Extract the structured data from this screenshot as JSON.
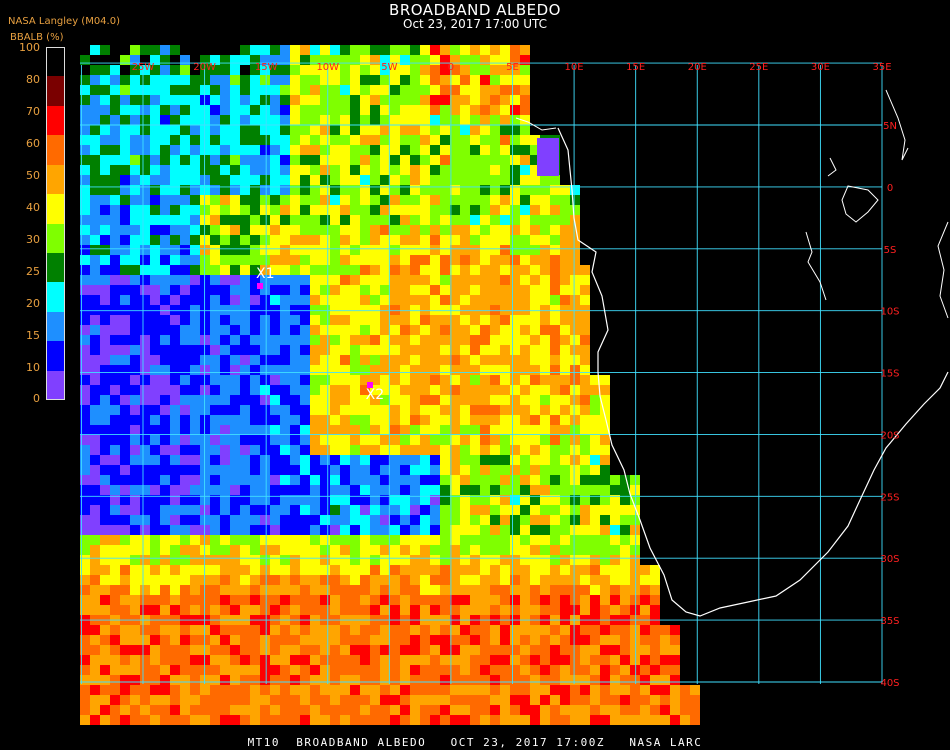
{
  "header": {
    "title": "BROADBAND ALBEDO",
    "datetime": "Oct 23, 2017 17:00 UTC",
    "source": "NASA Langley (M04.0)",
    "parameter": "BBALB (%)"
  },
  "legend": {
    "labels": [
      "100",
      "80",
      "70",
      "60",
      "50",
      "40",
      "30",
      "25",
      "20",
      "15",
      "10",
      "0"
    ],
    "colors": [
      "#000000",
      "#7a0000",
      "#ff0000",
      "#ff6a00",
      "#ffa500",
      "#ffff00",
      "#7fff00",
      "#008000",
      "#00ffff",
      "#1e8fff",
      "#0000ff",
      "#8040ff"
    ]
  },
  "map": {
    "lon_labels": [
      "25W",
      "20W",
      "15W",
      "10W",
      "5W",
      "0",
      "5E",
      "10E",
      "15E",
      "20E",
      "25E",
      "30E",
      "35E"
    ],
    "lat_labels": [
      "5N",
      "0",
      "5S",
      "10S",
      "15S",
      "20S",
      "25S",
      "30S",
      "35S",
      "40S"
    ],
    "markers": [
      {
        "label": "X1",
        "lon": -15.5,
        "lat": -8.0
      },
      {
        "label": "X2",
        "lon": -6.6,
        "lat": -16.0
      }
    ],
    "grid_color": "#40e0ff",
    "label_color": "#ff2020",
    "coast_color": "#ffffff"
  },
  "footer": {
    "text": "MT10  BROADBAND ALBEDO   OCT 23, 2017 17:00Z   NASA LARC"
  }
}
